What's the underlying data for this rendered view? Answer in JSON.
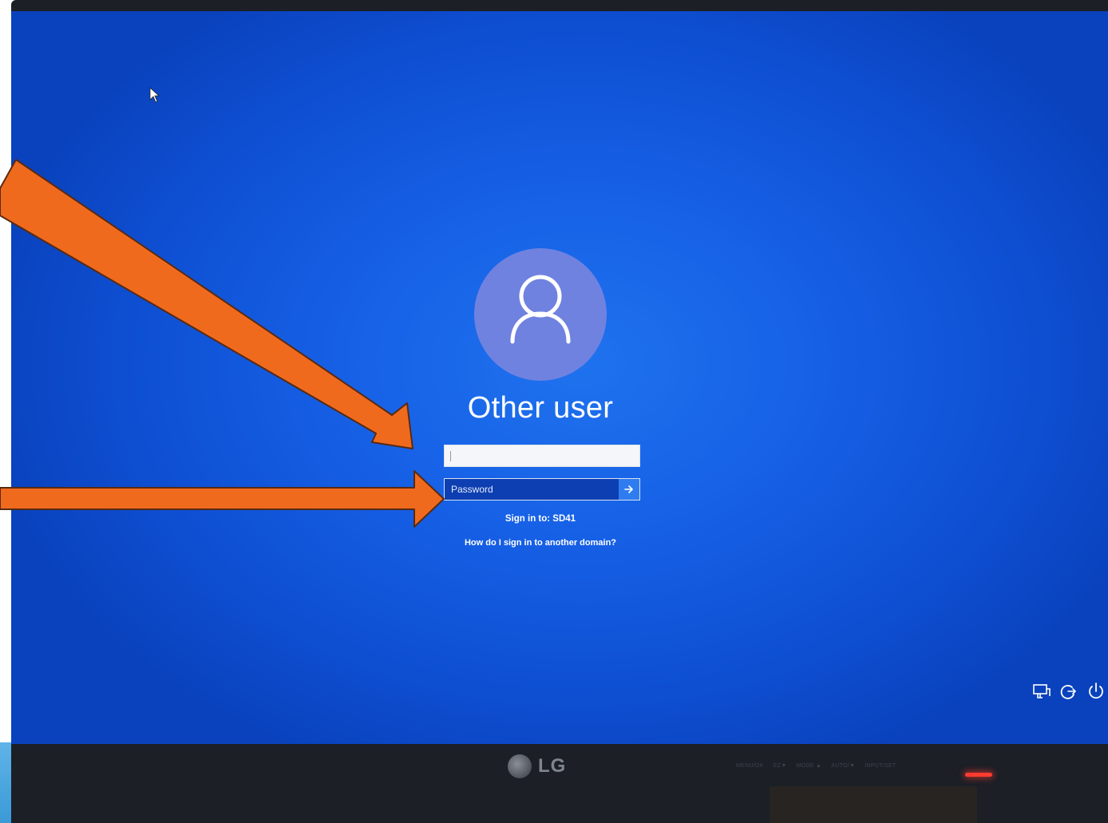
{
  "login": {
    "user_name": "Other user",
    "username_value": "",
    "password_placeholder": "Password",
    "sign_in_to": "Sign in to: SD41",
    "other_domain_link": "How do I sign in to another domain?"
  },
  "icons": {
    "avatar": "user-avatar-icon",
    "submit": "arrow-right-icon",
    "tray": [
      "network-icon",
      "accessibility-icon",
      "power-icon"
    ]
  },
  "monitor": {
    "brand": "LG",
    "controls": [
      "MENU/OK",
      "EZ▼",
      "MODE ▲",
      "AUTO/▼",
      "INPUT/SET"
    ]
  },
  "colors": {
    "screen_background": "#1660e6",
    "avatar_circle": "#7082e0",
    "annotation_arrow": "#f06a1e",
    "annotation_outline": "#5a2a10"
  }
}
